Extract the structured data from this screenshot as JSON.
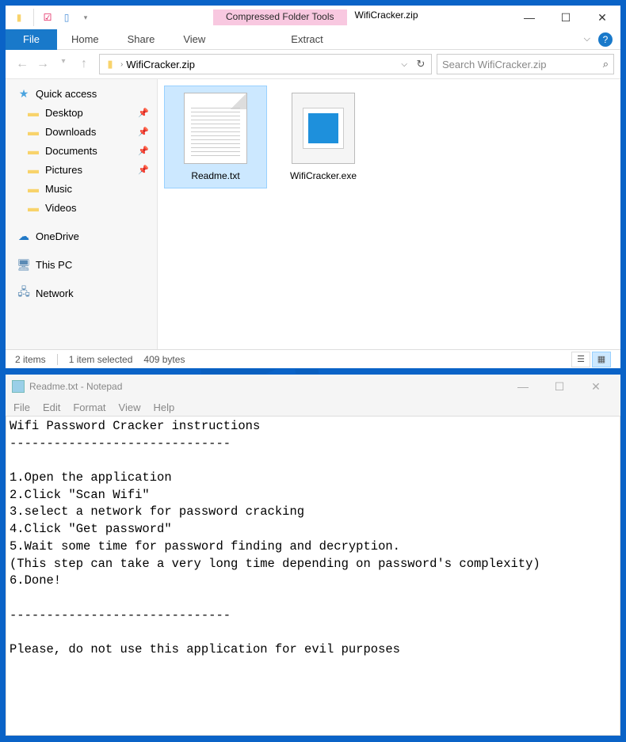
{
  "explorer": {
    "contextual_tab": "Compressed Folder Tools",
    "window_title": "WifiCracker.zip",
    "tabs": {
      "file": "File",
      "home": "Home",
      "share": "Share",
      "view": "View",
      "extract": "Extract"
    },
    "address": "WifiCracker.zip",
    "search_placeholder": "Search WifiCracker.zip",
    "sidebar": {
      "quick_access": "Quick access",
      "items": [
        {
          "label": "Desktop",
          "pin": true
        },
        {
          "label": "Downloads",
          "pin": true
        },
        {
          "label": "Documents",
          "pin": true
        },
        {
          "label": "Pictures",
          "pin": true
        },
        {
          "label": "Music",
          "pin": false
        },
        {
          "label": "Videos",
          "pin": false
        }
      ],
      "onedrive": "OneDrive",
      "thispc": "This PC",
      "network": "Network"
    },
    "files": [
      {
        "name": "Readme.txt",
        "selected": true,
        "type": "txt"
      },
      {
        "name": "WifiCracker.exe",
        "selected": false,
        "type": "exe"
      }
    ],
    "status": {
      "count": "2 items",
      "selected": "1 item selected",
      "size": "409 bytes"
    }
  },
  "notepad": {
    "title": "Readme.txt - Notepad",
    "menu": [
      "File",
      "Edit",
      "Format",
      "View",
      "Help"
    ],
    "content": "Wifi Password Cracker instructions\n------------------------------\n\n1.Open the application\n2.Click \"Scan Wifi\"\n3.select a network for password cracking\n4.Click \"Get password\"\n5.Wait some time for password finding and decryption.\n(This step can take a very long time depending on password's complexity)\n6.Done!\n\n------------------------------\n\nPlease, do not use this application for evil purposes"
  }
}
